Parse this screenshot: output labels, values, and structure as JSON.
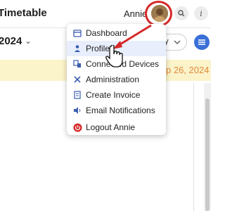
{
  "header": {
    "title": "Timetable",
    "user_name": "Annie",
    "search_icon": "search-icon",
    "info_icon": "info-icon",
    "info_glyph": "i"
  },
  "toolbar": {
    "year": "2024",
    "view_select": "ay"
  },
  "banner": {
    "date_text": "p 26, 2024"
  },
  "user_menu": {
    "items": [
      {
        "label": "Dashboard",
        "icon": "calendar-icon"
      },
      {
        "label": "Profile",
        "icon": "person-icon"
      },
      {
        "label": "Connected Devices",
        "icon": "devices-icon"
      },
      {
        "label": "Administration",
        "icon": "tools-icon"
      },
      {
        "label": "Create Invoice",
        "icon": "invoice-icon"
      },
      {
        "label": "Email Notifications",
        "icon": "speaker-icon"
      },
      {
        "label": "Logout Annie",
        "icon": "power-icon"
      }
    ]
  },
  "colors": {
    "accent": "#3a6fd8",
    "highlight": "#d62828",
    "banner": "#fbf3c9",
    "logout": "#d62828"
  }
}
